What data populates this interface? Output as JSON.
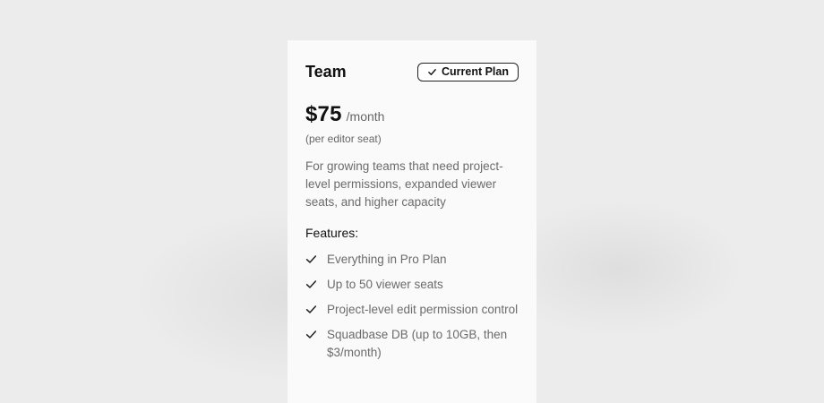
{
  "plan": {
    "name": "Team",
    "badge_label": "Current Plan",
    "price": "$75",
    "period": "/month",
    "seat_note": "(per editor seat)",
    "description": "For growing teams that need project-level permissions, expanded viewer seats, and higher capacity"
  },
  "features": {
    "heading": "Features:",
    "items": [
      {
        "label": "Everything in Pro Plan",
        "icon": "check-icon"
      },
      {
        "label": "Up to 50 viewer seats",
        "icon": "check-icon"
      },
      {
        "label": "Project-level edit permission control",
        "icon": "check-icon"
      },
      {
        "label": "Squadbase DB (up to 10GB, then $3/month)",
        "icon": "check-icon"
      }
    ]
  },
  "colors": {
    "background": "#ececec",
    "card": "#fafafa",
    "text_primary": "#111111",
    "text_muted": "#6b6b6b"
  }
}
